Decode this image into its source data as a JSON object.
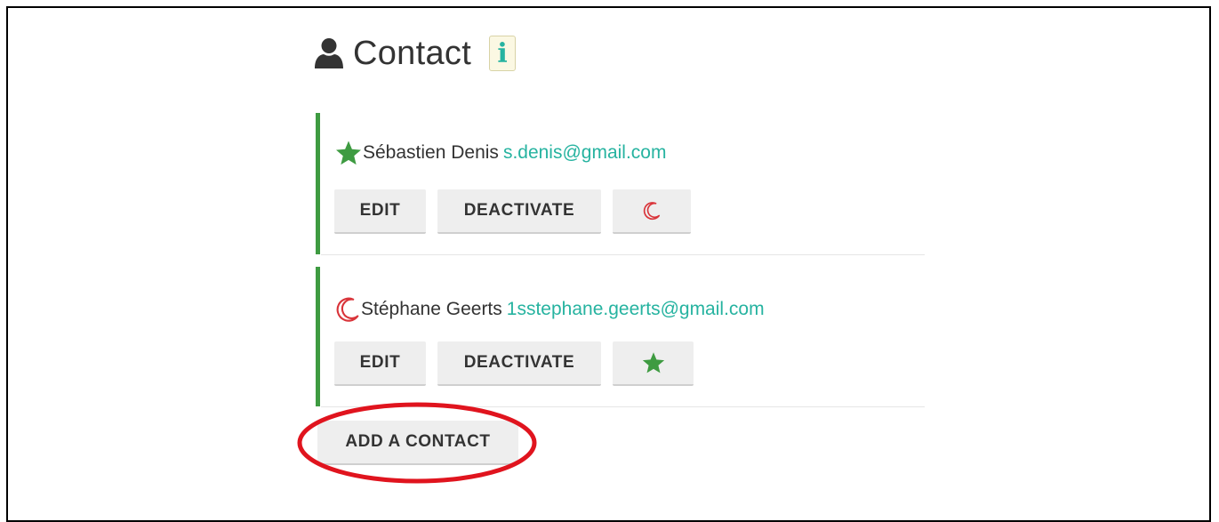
{
  "header": {
    "title": "Contact",
    "user_icon": "user-icon",
    "info_label": "i",
    "info_icon": "info-icon"
  },
  "contacts": [
    {
      "status_icon": "star-icon",
      "name": "Sébastien Denis",
      "email": "s.denis@gmail.com",
      "edit_label": "EDIT",
      "deactivate_label": "DEACTIVATE",
      "toggle_icon": "moon-icon"
    },
    {
      "status_icon": "moon-icon",
      "name": "Stéphane Geerts",
      "email": "1sstephane.geerts@gmail.com",
      "edit_label": "EDIT",
      "deactivate_label": "DEACTIVATE",
      "toggle_icon": "star-icon"
    }
  ],
  "add_contact_label": "ADD A CONTACT",
  "colors": {
    "accent_green": "#3e9b41",
    "email_teal": "#26b3a0",
    "moon_red": "#d9343a",
    "highlight_red": "#e0141e",
    "button_bg": "#eeeeee"
  }
}
